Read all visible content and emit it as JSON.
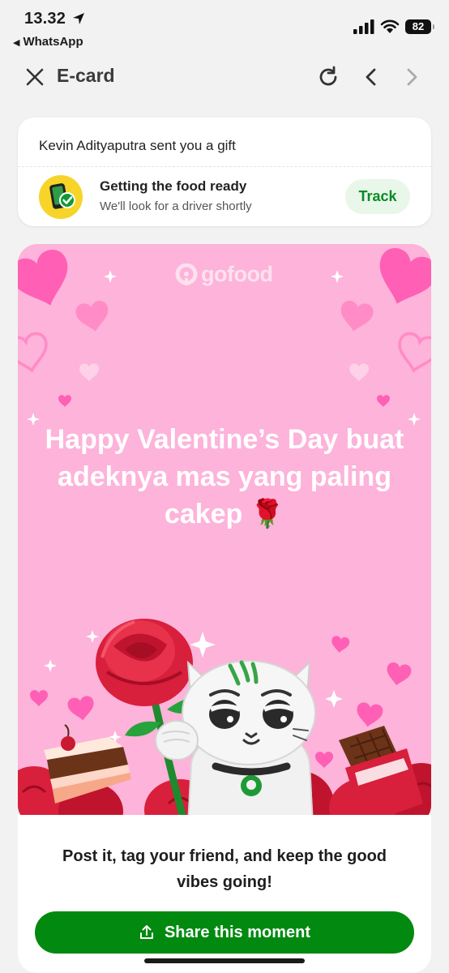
{
  "status_bar": {
    "time": "13.32",
    "back_app": "WhatsApp",
    "battery": "82"
  },
  "header": {
    "title": "E-card"
  },
  "gift": {
    "sender_text": "Kevin Adityaputra sent you a gift",
    "order_status_title": "Getting the food ready",
    "order_status_subtitle": "We'll look for a driver shortly",
    "track_label": "Track"
  },
  "ecard": {
    "brand": "gofood",
    "greeting": "Happy Valentine’s Day buat adeknya mas yang paling cakep 🌹"
  },
  "footer": {
    "cta_text": "Post it, tag your friend, and keep the good vibes going!",
    "share_label": "Share this moment"
  },
  "colors": {
    "card_pink": "#fdb3da",
    "heart_pink": "#ff5fb4",
    "brand_green": "#028a10",
    "track_bg": "#e8f7e9"
  }
}
